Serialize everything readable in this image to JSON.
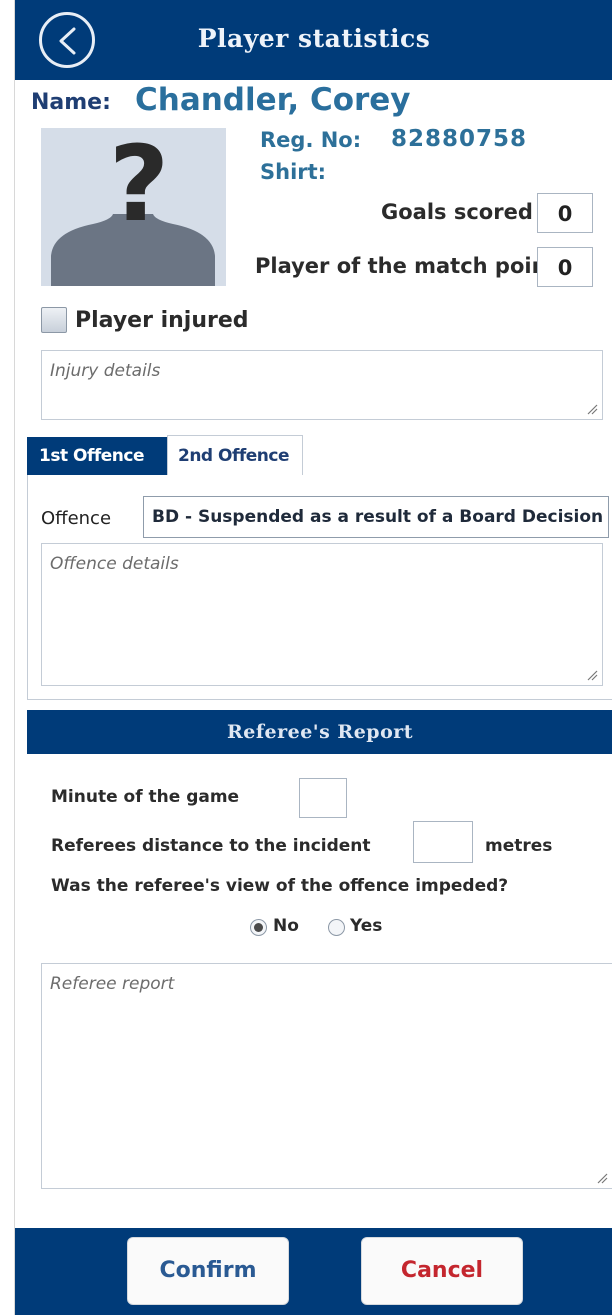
{
  "header": {
    "title": "Player statistics",
    "back_icon": "back-arrow-icon"
  },
  "player": {
    "name_label": "Name:",
    "name": "Chandler, Corey",
    "reg_label": "Reg. No:",
    "reg_no": "82880758",
    "shirt_label": "Shirt:",
    "shirt": "",
    "avatar_icon": "unknown-player-avatar-icon",
    "goals_label": "Goals scored",
    "goals": "0",
    "potm_label": "Player of the match points",
    "potm": "0",
    "injured_label": "Player injured",
    "injured_checked": false,
    "injury_placeholder": "Injury details"
  },
  "offence": {
    "tabs": [
      {
        "label": "1st Offence",
        "active": true
      },
      {
        "label": "2nd Offence",
        "active": false
      }
    ],
    "offence_label": "Offence",
    "offence_selected": "BD - Suspended as a result of a Board Decision",
    "details_placeholder": "Offence details"
  },
  "referee": {
    "title": "Referee's Report",
    "minute_label": "Minute of the game",
    "minute_value": "",
    "distance_label": "Referees distance to the incident",
    "distance_value": "",
    "distance_unit": "metres",
    "impeded_question": "Was the referee's view of the offence impeded?",
    "options": [
      {
        "label": "No",
        "checked": true
      },
      {
        "label": "Yes",
        "checked": false
      }
    ],
    "report_placeholder": "Referee report"
  },
  "footer": {
    "confirm_label": "Confirm",
    "cancel_label": "Cancel"
  },
  "colors": {
    "primary": "#003b79",
    "name_blue": "#2a6f9d",
    "cancel_red": "#c4262e",
    "confirm_blue": "#2a5a93"
  }
}
